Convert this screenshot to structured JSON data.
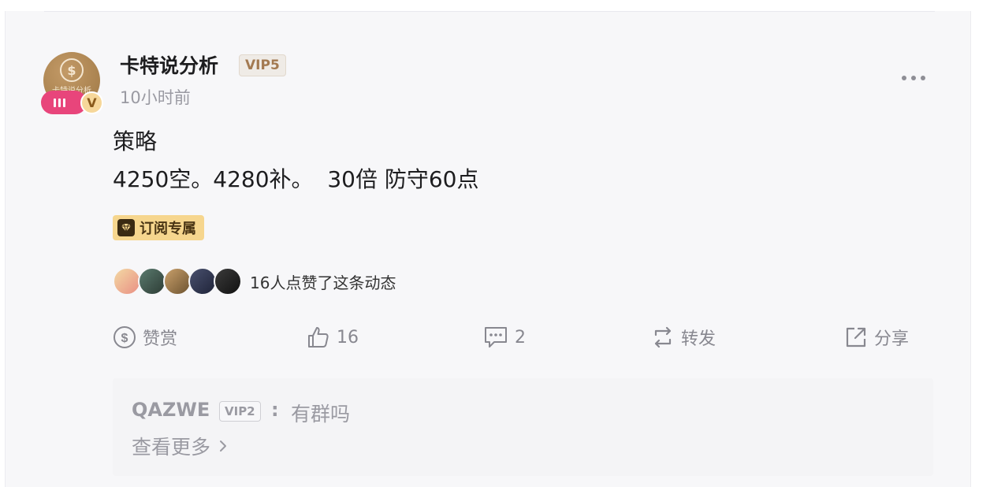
{
  "author": {
    "name": "卡特说分析",
    "vip": "VIP5",
    "time": "10小时前",
    "avatar_text": "卡特说分析",
    "verified_mark": "V"
  },
  "post": {
    "title": "策略",
    "body": "4250空。4280补。  30倍 防守60点",
    "tag": "订阅专属"
  },
  "likes": {
    "text": "16人点赞了这条动态",
    "avatars": [
      "liker-1",
      "liker-2",
      "liker-3",
      "liker-4",
      "liker-5"
    ]
  },
  "actions": {
    "reward": "赞赏",
    "like_count": "16",
    "comment_count": "2",
    "repost": "转发",
    "share": "分享"
  },
  "reply": {
    "user": "QAZWE",
    "vip": "VIP2",
    "colon": ":",
    "text": "有群吗",
    "view_more": "查看更多"
  },
  "icons": [
    "more-icon",
    "reward-icon",
    "like-icon",
    "comment-icon",
    "repost-icon",
    "share-icon",
    "diamond-icon",
    "chevron-right-icon",
    "live-icon"
  ],
  "colors": {
    "card_bg": "#f7f7f9",
    "live_badge": "#e8457b",
    "tag_bg": "#f6d68e",
    "muted": "#9a9aa2"
  }
}
